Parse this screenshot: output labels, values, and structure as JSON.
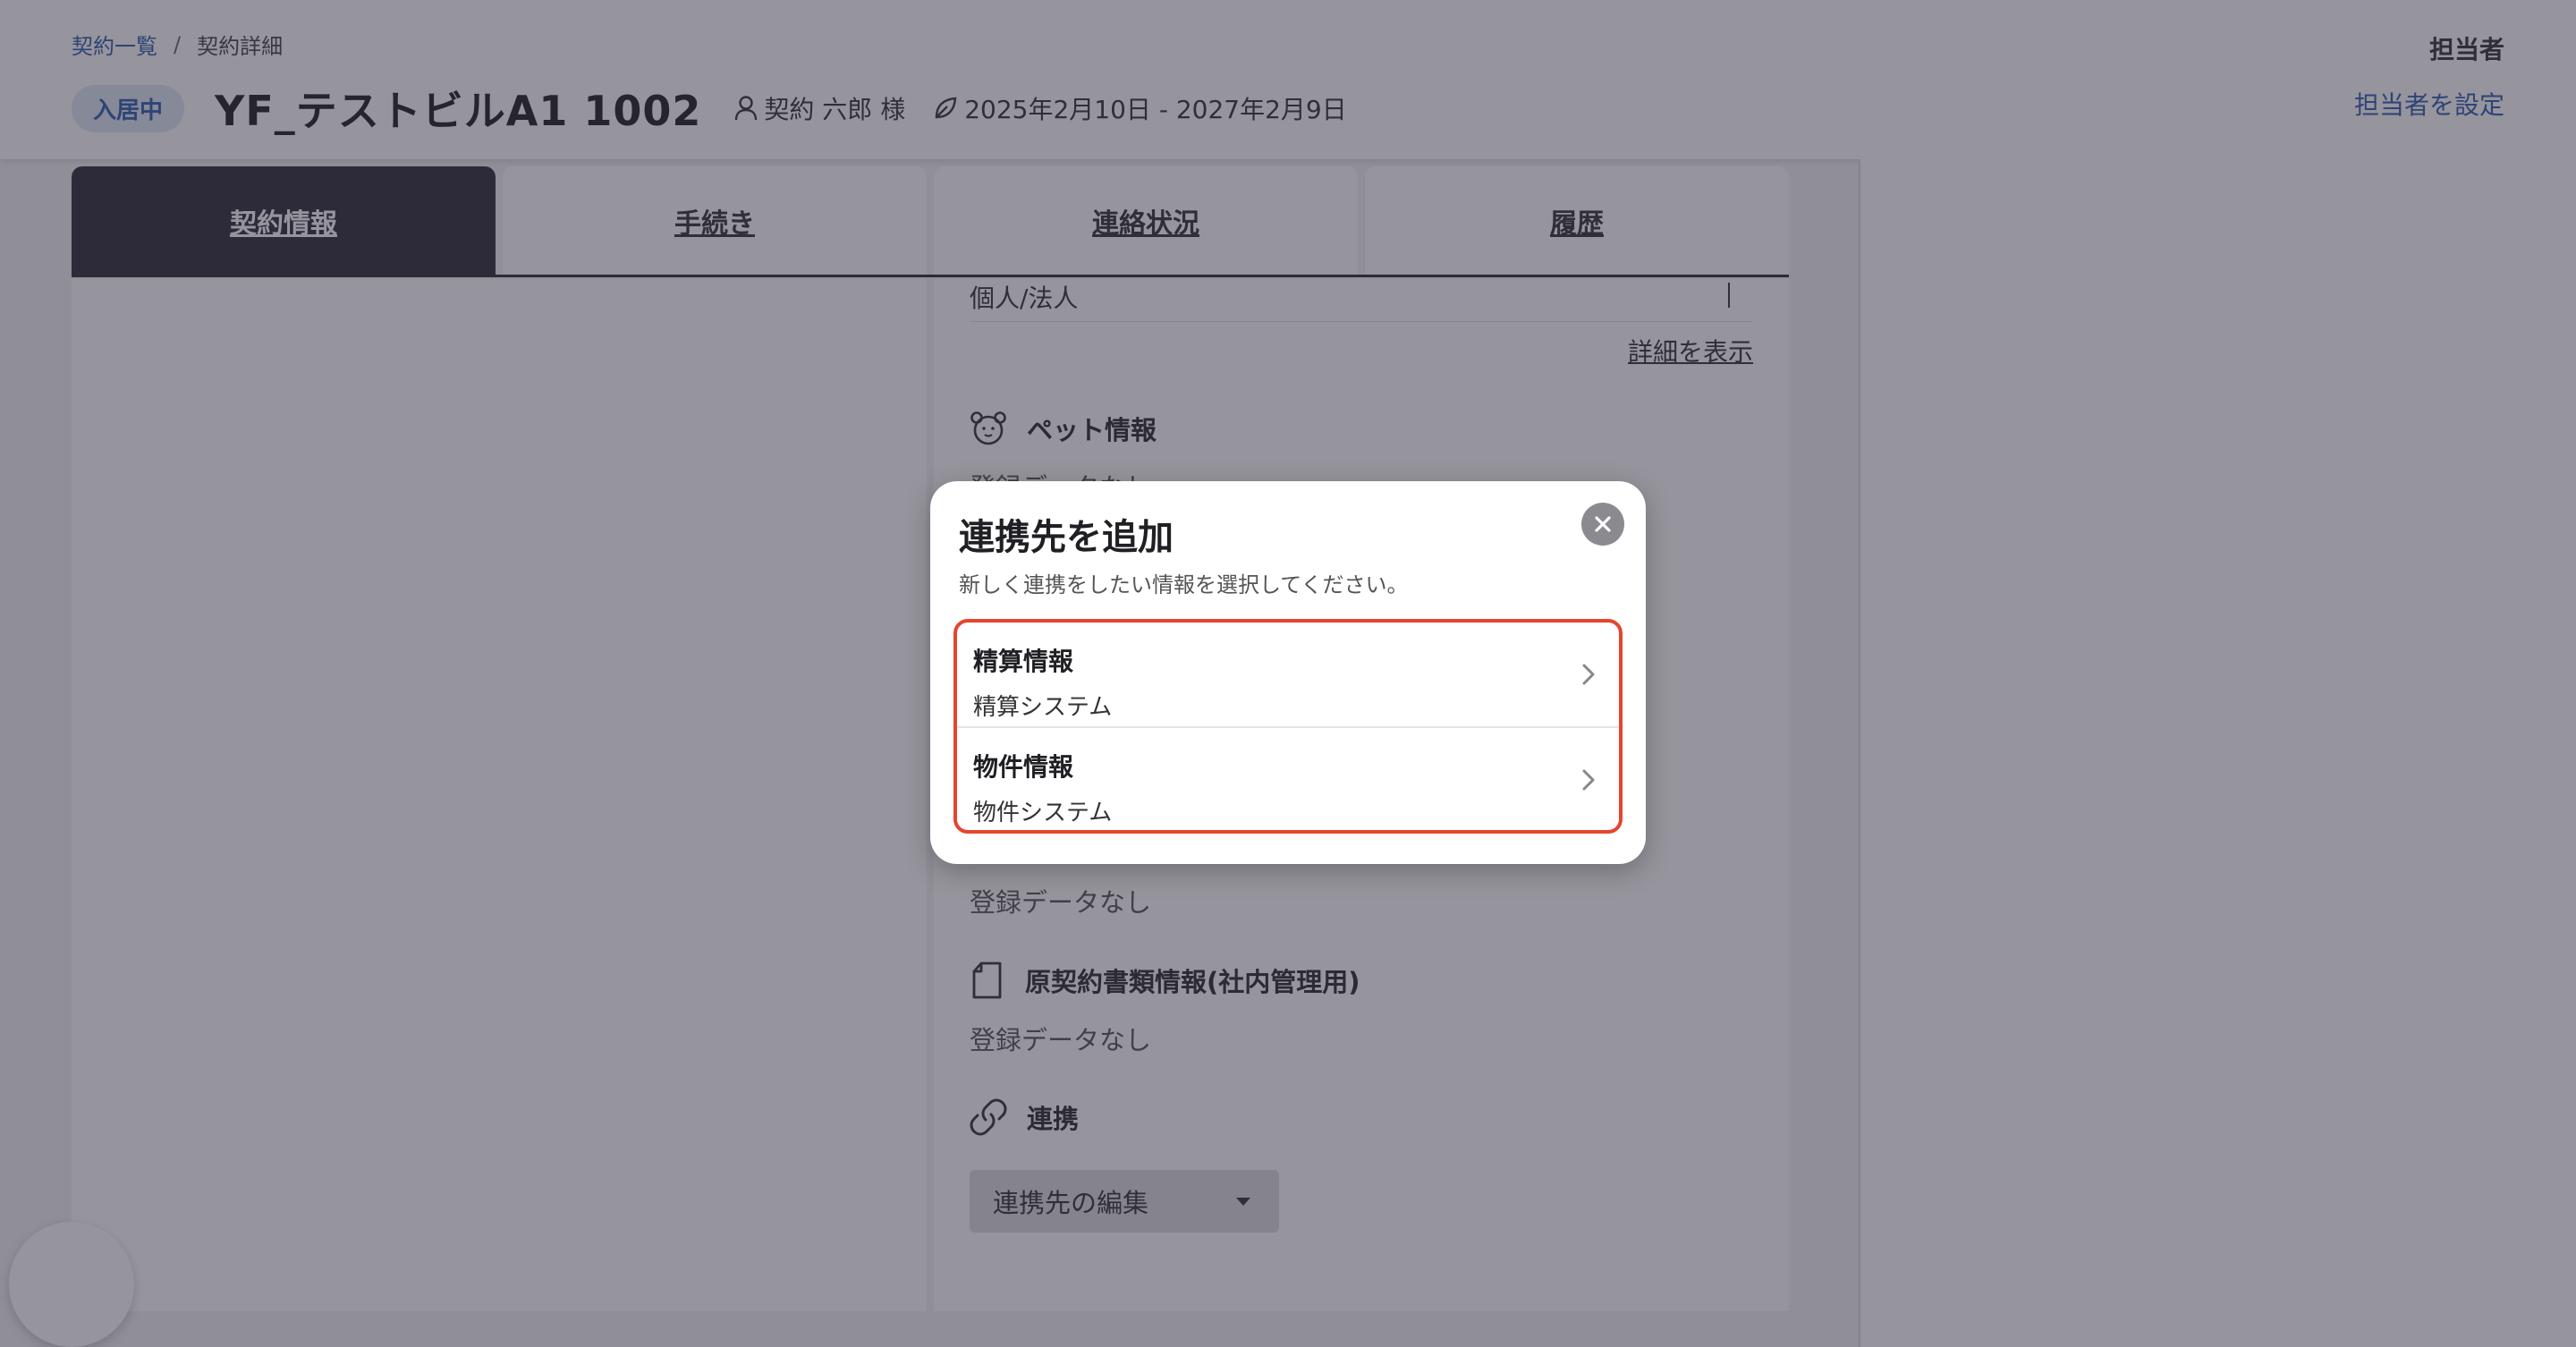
{
  "breadcrumb": {
    "parent": "契約一覧",
    "separator": "/",
    "current": "契約詳細"
  },
  "header": {
    "status_badge": "入居中",
    "title": "YF_テストビルA1 1002",
    "tenant": "契約 六郎 様",
    "period": "2025年2月10日 - 2027年2月9日",
    "assignee_label": "担当者",
    "assignee_link": "担当者を設定"
  },
  "tabs": [
    {
      "label": "契約情報",
      "active": true
    },
    {
      "label": "手続き",
      "active": false
    },
    {
      "label": "連絡状況",
      "active": false
    },
    {
      "label": "履歴",
      "active": false
    }
  ],
  "content": {
    "individual_row": "個人/法人",
    "details_link": "詳細を表示",
    "pet_section": "ペット情報",
    "empty_text": "登録データなし",
    "original_docs_section": "原契約書類情報(社内管理用)",
    "link_section": "連携",
    "edit_dropdown": "連携先の編集"
  },
  "modal": {
    "title": "連携先を追加",
    "subtitle": "新しく連携をしたい情報を選択してください。",
    "options": [
      {
        "title": "精算情報",
        "subtitle": "精算システム"
      },
      {
        "title": "物件情報",
        "subtitle": "物件システム"
      }
    ],
    "highlight_color": "#e5452f"
  },
  "icons": {
    "tenant": "person-icon",
    "period": "leaf-icon",
    "pet": "bear-icon",
    "docs": "document-icon",
    "link": "link-icon",
    "close": "close-icon",
    "chevron": "chevron-right-icon"
  }
}
